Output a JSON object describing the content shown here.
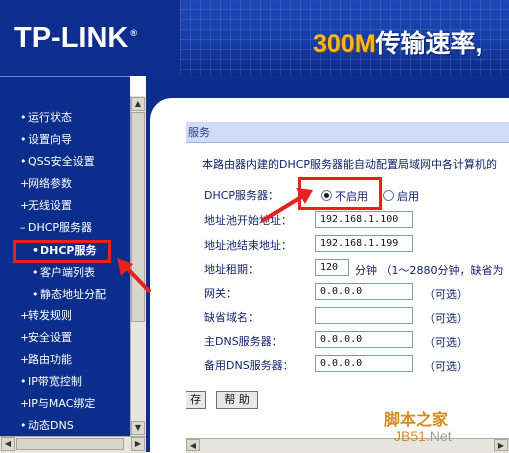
{
  "header": {
    "logo": "TP-LINK",
    "logo_mark": "®",
    "slogan_number": "300M",
    "slogan_text": "传输速率,"
  },
  "sidebar": {
    "items": [
      {
        "label": "运行状态",
        "bullet": "•"
      },
      {
        "label": "设置向导",
        "bullet": "•"
      },
      {
        "label": "QSS安全设置",
        "bullet": "•"
      },
      {
        "label": "网络参数",
        "bullet": "+"
      },
      {
        "label": "无线设置",
        "bullet": "+"
      },
      {
        "label": "DHCP服务器",
        "bullet": "–"
      },
      {
        "label": "DHCP服务",
        "bullet": "•"
      },
      {
        "label": "客户端列表",
        "bullet": "•"
      },
      {
        "label": "静态地址分配",
        "bullet": "•"
      },
      {
        "label": "转发规则",
        "bullet": "+"
      },
      {
        "label": "安全设置",
        "bullet": "+"
      },
      {
        "label": "路由功能",
        "bullet": "+"
      },
      {
        "label": "IP带宽控制",
        "bullet": "•"
      },
      {
        "label": "IP与MAC绑定",
        "bullet": "+"
      },
      {
        "label": "动态DNS",
        "bullet": "•"
      }
    ]
  },
  "main": {
    "section_title": "服务",
    "description": "本路由器内建的DHCP服务器能自动配置局域网中各计算机的",
    "fields": {
      "dhcp_server_label": "DHCP服务器：",
      "radio_disable": "不启用",
      "radio_enable": "启用",
      "pool_start_label": "地址池开始地址：",
      "pool_start_value": "192.168.1.100",
      "pool_end_label": "地址池结束地址：",
      "pool_end_value": "192.168.1.199",
      "lease_label": "地址租期：",
      "lease_value": "120",
      "lease_suffix": "分钟 （1～2880分钟，缺省为",
      "gateway_label": "网关：",
      "gateway_value": "0.0.0.0",
      "domain_label": "缺省域名：",
      "domain_value": "",
      "dns1_label": "主DNS服务器：",
      "dns1_value": "0.0.0.0",
      "dns2_label": "备用DNS服务器：",
      "dns2_value": "0.0.0.0",
      "optional": "（可选）"
    },
    "buttons": {
      "save": "存",
      "help": "帮 助"
    }
  },
  "watermark": {
    "cn": "脚本之家",
    "jb51": "JB51",
    "dot_net": ".Net"
  },
  "scroll": {
    "up": "▲",
    "down": "▼",
    "left": "◀",
    "right": "▶"
  },
  "colors": {
    "nav_bg": "#0b2e8d",
    "highlight": "#e8221a",
    "slogan": "#ffb61b"
  }
}
